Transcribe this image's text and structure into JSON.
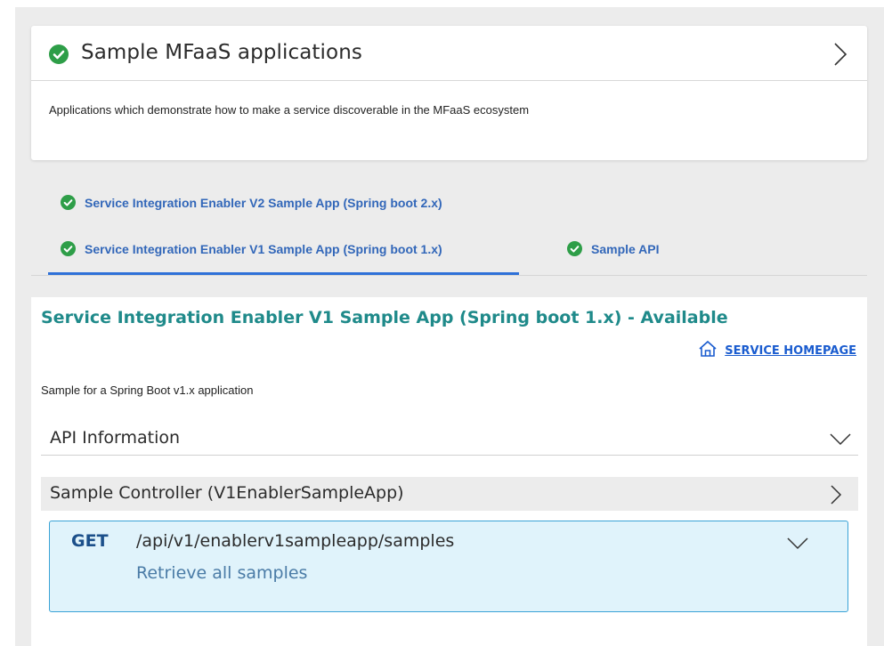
{
  "header": {
    "title": "Sample MFaaS applications",
    "description": "Applications which demonstrate how to make a service discoverable in the MFaaS ecosystem"
  },
  "tabs": [
    {
      "label": "Service Integration Enabler V2 Sample App (Spring boot 2.x)",
      "status": "available"
    },
    {
      "label": "Service Integration Enabler V1 Sample App (Spring boot 1.x)",
      "status": "available",
      "selected": true
    },
    {
      "label": "Sample API",
      "status": "available"
    }
  ],
  "service": {
    "title": "Service Integration Enabler V1 Sample App (Spring boot 1.x) - Available",
    "homepage_label": "SERVICE HOMEPAGE",
    "description": "Sample for a Spring Boot v1.x application"
  },
  "api_info": {
    "label": "API Information"
  },
  "controller": {
    "label": "Sample Controller (V1EnablerSampleApp)"
  },
  "operation": {
    "method": "GET",
    "path": "/api/v1/enablerv1sampleapp/samples",
    "summary": "Retrieve all samples"
  },
  "colors": {
    "accent_teal": "#1f8a8a",
    "tab_blue": "#3267b9",
    "status_green": "#2e9e48",
    "op_bg": "#e0f3fb",
    "op_border": "#3aa3d6"
  },
  "icons": [
    "check-circle-icon",
    "chevron-right-icon",
    "home-icon",
    "chevron-down-icon"
  ]
}
